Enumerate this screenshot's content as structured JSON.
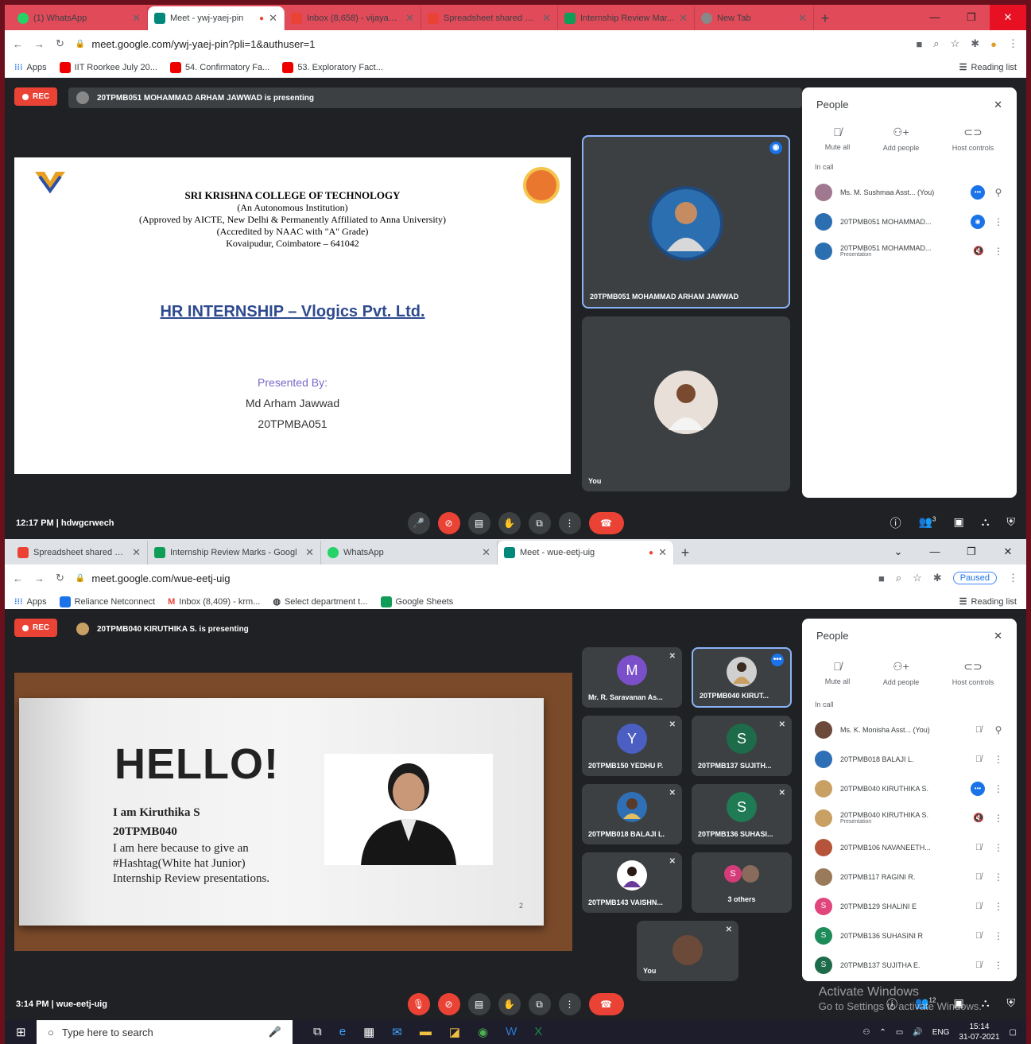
{
  "window1": {
    "tabs": [
      "(1) WhatsApp",
      "Meet - ywj-yaej-pin",
      "Inbox (8,658) - vijayasu...",
      "Spreadsheet shared wi...",
      "Internship Review Mar...",
      "New Tab"
    ],
    "url": "meet.google.com/ywj-yaej-pin?pli=1&authuser=1",
    "bookmarks": [
      "Apps",
      "IIT Roorkee July 20...",
      "54. Confirmatory Fa...",
      "53. Exploratory Fact..."
    ],
    "reading_list": "Reading list",
    "rec": "REC",
    "presenting": "20TPMB051 MOHAMMAD ARHAM JAWWAD is presenting",
    "slide": {
      "college": "SRI KRISHNA COLLEGE OF TECHNOLOGY",
      "line2": "(An Autonomous Institution)",
      "line3": "(Approved by AICTE, New Delhi & Permanently Affiliated to Anna University)",
      "line4": "(Accredited by NAAC with \"A\" Grade)",
      "line5": "Kovaipudur, Coimbatore – 641042",
      "title": "HR INTERNSHIP – Vlogics Pvt. Ltd.",
      "presented_by": "Presented By:",
      "name": "Md Arham Jawwad",
      "roll": "20TPMBA051"
    },
    "tile_main_name": "20TPMB051 MOHAMMAD ARHAM JAWWAD",
    "tile_you": "You",
    "people": {
      "title": "People",
      "mute_all": "Mute all",
      "add_people": "Add people",
      "host_controls": "Host controls",
      "in_call": "In call",
      "rows": [
        {
          "name": "Ms. M. Sushmaa Asst... (You)",
          "sub": ""
        },
        {
          "name": "20TPMB051 MOHAMMAD...",
          "sub": ""
        },
        {
          "name": "20TPMB051 MOHAMMAD...",
          "sub": "Presentation"
        }
      ]
    },
    "time": "12:17 PM",
    "meeting_code": "hdwgcrwech",
    "people_count": "3"
  },
  "window2": {
    "tabs": [
      "Spreadsheet shared with you: \"In",
      "Internship Review Marks - Googl",
      "WhatsApp",
      "Meet - wue-eetj-uig"
    ],
    "url": "meet.google.com/wue-eetj-uig",
    "paused": "Paused",
    "bookmarks": [
      "Apps",
      "Reliance Netconnect",
      "Inbox (8,409) - krm...",
      "Select department t...",
      "Google Sheets"
    ],
    "reading_list": "Reading list",
    "rec": "REC",
    "presenting": "20TPMB040 KIRUTHIKA S. is presenting",
    "slide": {
      "hello": "HELLO!",
      "line1": "I am Kiruthika S",
      "line2": "20TPMB040",
      "line3": "I am here because to give an",
      "line4": "#Hashtag(White hat Junior)",
      "line5": "Internship Review presentations.",
      "page": "2"
    },
    "tiles": [
      {
        "name": "Mr. R. Saravanan As...",
        "initial": "M",
        "color": "#7b4fc9"
      },
      {
        "name": "20TPMB040 KIRUT...",
        "initial": "",
        "color": "#d0d0d0"
      },
      {
        "name": "20TPMB150 YEDHU P.",
        "initial": "Y",
        "color": "#4a5fc1"
      },
      {
        "name": "20TPMB137 SUJITH...",
        "initial": "S",
        "color": "#1e6b4a"
      },
      {
        "name": "20TPMB018 BALAJI L.",
        "initial": "",
        "color": "#2f6fb5"
      },
      {
        "name": "20TPMB136 SUHASI...",
        "initial": "S",
        "color": "#1e7b54"
      },
      {
        "name": "20TPMB143 VAISHN...",
        "initial": "",
        "color": "#ffffff"
      },
      {
        "name": "3 others",
        "initial": "S",
        "color": "#d53b78"
      },
      {
        "name": "You",
        "initial": "",
        "color": "#555"
      }
    ],
    "people": {
      "title": "People",
      "mute_all": "Mute all",
      "add_people": "Add people",
      "host_controls": "Host controls",
      "in_call": "In call",
      "rows": [
        {
          "name": "Ms. K. Monisha Asst... (You)",
          "sub": "",
          "initial": "",
          "color": "#6b4a3a"
        },
        {
          "name": "20TPMB018 BALAJI L.",
          "sub": "",
          "initial": "",
          "color": "#2f6fb5"
        },
        {
          "name": "20TPMB040 KIRUTHIKA S.",
          "sub": "",
          "initial": "",
          "color": "#c9a063"
        },
        {
          "name": "20TPMB040 KIRUTHIKA S.",
          "sub": "Presentation",
          "initial": "",
          "color": "#c9a063"
        },
        {
          "name": "20TPMB106 NAVANEETH...",
          "sub": "",
          "initial": "",
          "color": "#b5543a"
        },
        {
          "name": "20TPMB117 RAGINI R.",
          "sub": "",
          "initial": "",
          "color": "#9a7a5a"
        },
        {
          "name": "20TPMB129 SHALINI E",
          "sub": "",
          "initial": "S",
          "color": "#e0457b"
        },
        {
          "name": "20TPMB136 SUHASINI R",
          "sub": "",
          "initial": "S",
          "color": "#1e8b5a"
        },
        {
          "name": "20TPMB137 SUJITHA E.",
          "sub": "",
          "initial": "S",
          "color": "#1e6b4a"
        }
      ]
    },
    "time": "3:14 PM",
    "meeting_code": "wue-eetj-uig",
    "people_count": "12",
    "watermark_title": "Activate Windows",
    "watermark_sub": "Go to Settings to activate Windows."
  },
  "taskbar": {
    "search_placeholder": "Type here to search",
    "lang": "ENG",
    "time": "15:14",
    "date": "31-07-2021"
  }
}
